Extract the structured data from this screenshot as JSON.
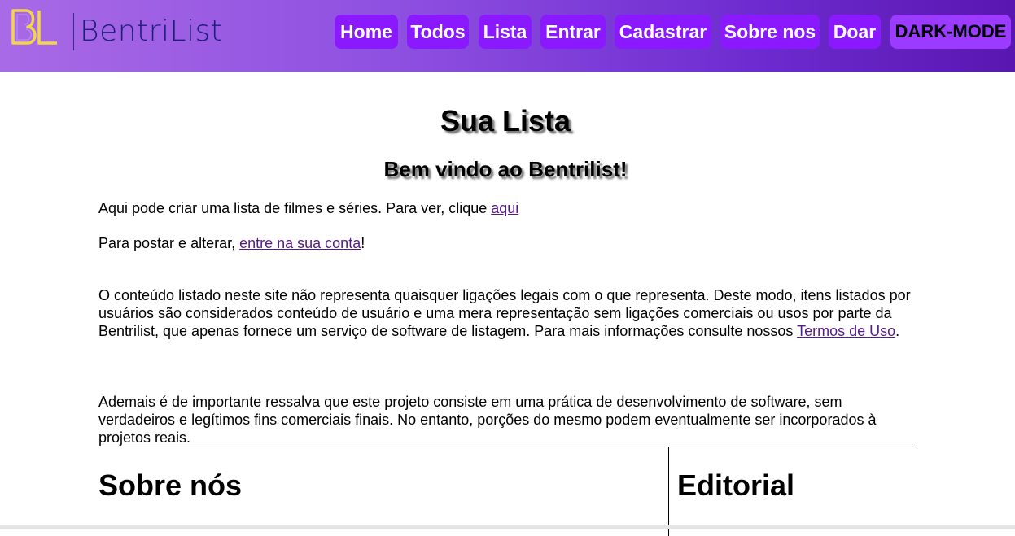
{
  "header": {
    "logo_alt": "BL",
    "brand": "BentriList",
    "nav": [
      {
        "label": "Home"
      },
      {
        "label": "Todos"
      },
      {
        "label": "Lista"
      },
      {
        "label": "Entrar"
      },
      {
        "label": "Cadastrar"
      },
      {
        "label": "Sobre nos"
      },
      {
        "label": "Doar"
      },
      {
        "label": "DARK-MODE"
      }
    ]
  },
  "main": {
    "title": "Sua Lista",
    "subtitle": "Bem vindo ao Bentrilist!",
    "p1_text": "Aqui pode criar uma lista de filmes e séries. Para ver, clique ",
    "p1_link": "aqui",
    "p2_text": "Para postar e alterar, ",
    "p2_link": "entre na sua conta",
    "p2_end": "!",
    "disclaimer_text": "O conteúdo listado neste site não representa quaisquer ligações legais com o que representa. Deste modo, itens listados por usuários são considerados conteúdo de usuário e uma mera representação sem ligações comerciais ou usos por parte da Bentrilist, que apenas fornece um serviço de software de listagem. Para mais informações consulte nossos ",
    "disclaimer_link": "Termos de Uso",
    "disclaimer_end": ".",
    "note": "Ademais é de importante ressalva que este projeto consiste em uma prática de desenvolvimento de software, sem verdadeiros e legítimos fins comerciais finais. No entanto, porções do mesmo podem eventualmente ser incorporados à projetos reais.",
    "about_heading": "Sobre nós",
    "editorial_heading": "Editorial"
  },
  "colors": {
    "nav_button": "#8a19ff",
    "header_gradient_start": "#a96ae6",
    "header_gradient_end": "#5a16b0",
    "link": "#551a8b",
    "brand_text": "#1b1f7a",
    "logo_gold": "#f3d54a"
  }
}
